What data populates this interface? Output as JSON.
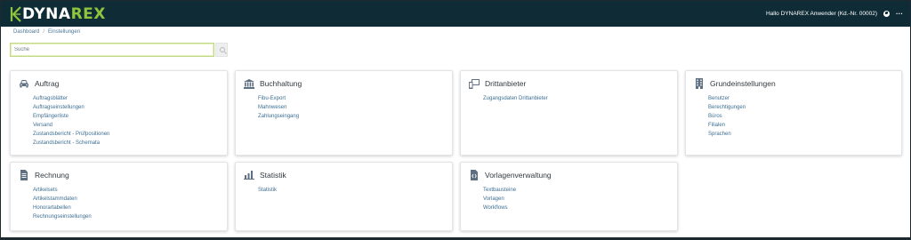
{
  "header": {
    "logo_prefix": "DYNA",
    "logo_suffix": "REX",
    "greeting": "Hallo DYNAREX Anwender (Kd.-Nr. 00002)",
    "menu_glyph": "···",
    "icons": [
      "globe-icon",
      "more-icon"
    ],
    "colors": {
      "background": "#0f2c36",
      "accent": "#8fc43d"
    }
  },
  "breadcrumb": {
    "home": "Dashboard",
    "separator": "/",
    "current": "Einstellungen"
  },
  "search": {
    "placeholder": "Suche",
    "value": ""
  },
  "cards": [
    {
      "title": "Auftrag",
      "icon": "car-icon",
      "links": [
        "Auftragsblätter",
        "Auftragseinstellungen",
        "Empfängerliste",
        "Versand",
        "Zustandsbericht - Prüfpositionen",
        "Zustandsbericht - Schemata"
      ]
    },
    {
      "title": "Buchhaltung",
      "icon": "bank-icon",
      "links": [
        "Fibu-Export",
        "Mahnwesen",
        "Zahlungseingang"
      ]
    },
    {
      "title": "Drittanbieter",
      "icon": "devices-icon",
      "links": [
        "Zugangsdaten Drittanbieter"
      ]
    },
    {
      "title": "Grundeinstellungen",
      "icon": "building-icon",
      "links": [
        "Benutzer",
        "Berechtigungen",
        "Büros",
        "Filialen",
        "Sprachen"
      ]
    },
    {
      "title": "Rechnung",
      "icon": "invoice-icon",
      "links": [
        "Artikelsets",
        "Artikelstammdaten",
        "Honorartabellen",
        "Rechnungseinstellungen"
      ]
    },
    {
      "title": "Statistik",
      "icon": "bar-chart-icon",
      "links": [
        "Statistik"
      ]
    },
    {
      "title": "Vorlagenverwaltung",
      "icon": "code-file-icon",
      "links": [
        "Textbausteine",
        "Vorlagen",
        "Workflows"
      ]
    }
  ]
}
